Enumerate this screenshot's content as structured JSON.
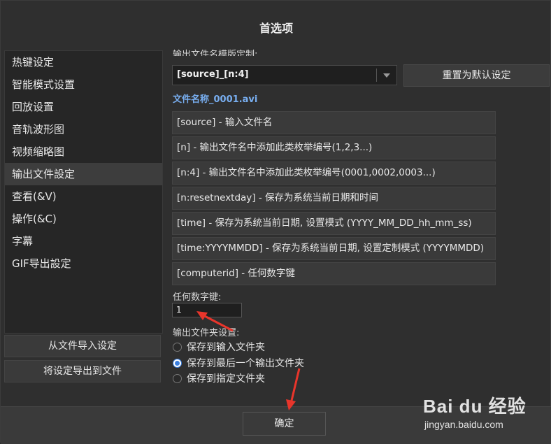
{
  "window": {
    "title": "首选项"
  },
  "sidebar": {
    "items": [
      {
        "label": "热键设定"
      },
      {
        "label": "智能模式设置"
      },
      {
        "label": "回放设置"
      },
      {
        "label": "音轨波形图"
      },
      {
        "label": "视频缩略图"
      },
      {
        "label": "输出文件設定",
        "active": true
      },
      {
        "label": "查看(&V)"
      },
      {
        "label": "操作(&C)"
      },
      {
        "label": "字幕"
      },
      {
        "label": "GIF导出設定"
      }
    ],
    "import_button": "从文件导入设定",
    "export_button": "将设定导出到文件"
  },
  "main": {
    "template_label": "输出文件名模版定制:",
    "template_value": "[source]_[n:4]",
    "reset_button": "重置为默认设定",
    "filename_preview": "文件名称_0001.avi",
    "tags": [
      "[source] - 输入文件名",
      "[n] - 输出文件名中添加此类枚举编号(1,2,3...)",
      "[n:4] - 输出文件名中添加此类枚举编号(0001,0002,0003...)",
      "[n:resetnextday] - 保存为系统当前日期和时间",
      "[time] - 保存为系统当前日期, 设置模式 (YYYY_MM_DD_hh_mm_ss)",
      "[time:YYYYMMDD] - 保存为系统当前日期, 设置定制模式 (YYYYMMDD)",
      "[computerid] - 任何数字键"
    ],
    "number_label": "任何数字键:",
    "number_value": "1",
    "folder_label": "输出文件夹设置:",
    "folder_options": [
      {
        "label": "保存到输入文件夹",
        "checked": false
      },
      {
        "label": "保存到最后一个输出文件夹",
        "checked": true
      },
      {
        "label": "保存到指定文件夹",
        "checked": false
      }
    ]
  },
  "footer": {
    "ok_button": "确定"
  },
  "watermark": {
    "brand": "Bai du 经验",
    "url": "jingyan.baidu.com"
  },
  "colors": {
    "accent": "#3a7fe0",
    "annotation_arrow": "#e8352b",
    "link": "#78aef0"
  }
}
